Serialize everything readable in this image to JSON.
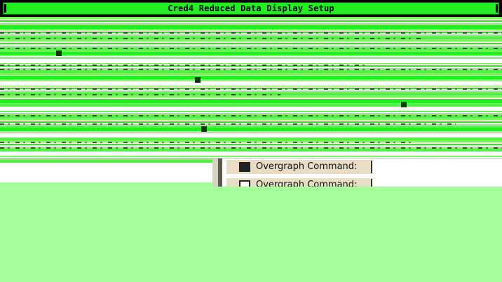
{
  "window": {
    "title": "Cred4 Reduced Data Display Setup"
  },
  "overgraph_rows": [
    {
      "label": "Overgraph Command:",
      "checked": true
    },
    {
      "label": "Overgraph Command:",
      "checked": false
    }
  ],
  "colors": {
    "title_bar": "#22ee22",
    "background": "#a4fe9a",
    "panel": "#e8dcc4"
  }
}
